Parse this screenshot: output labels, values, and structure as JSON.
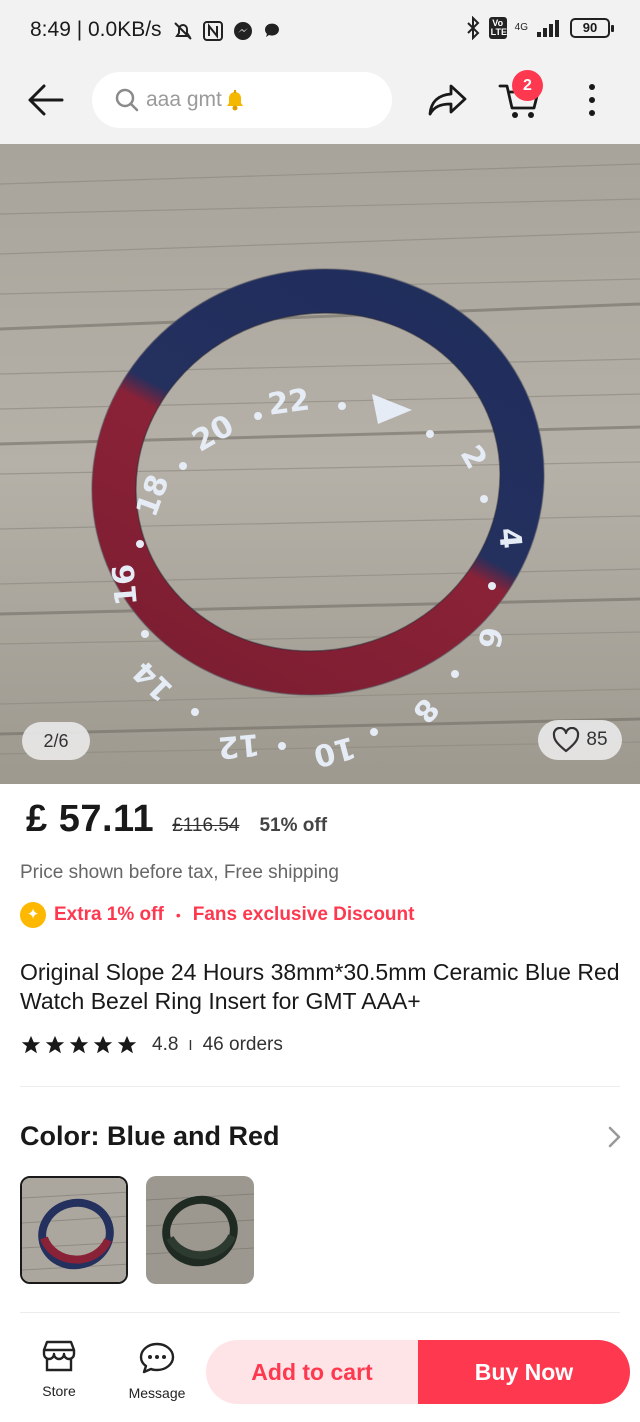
{
  "status_bar": {
    "time": "8:49",
    "net_speed": "0.0KB/s",
    "network": "4G",
    "volte": "Vo LTE",
    "battery": "90"
  },
  "nav": {
    "search_query": "aaa gmt",
    "cart_count": "2"
  },
  "gallery": {
    "counter": "2/6",
    "wishlist_count": "85"
  },
  "price": {
    "current": "£ 57.11",
    "original": "£116.54",
    "discount": "51% off",
    "tax_note": "Price shown before tax, Free shipping"
  },
  "promo": {
    "extra": "Extra 1% off",
    "fans": "Fans exclusive Discount"
  },
  "product": {
    "title": "Original Slope 24 Hours 38mm*30.5mm Ceramic Blue Red Watch Bezel Ring Insert for GMT AAA+",
    "rating": "4.8",
    "rating_stars": 5,
    "orders": "46 orders"
  },
  "variant": {
    "heading": "Color: Blue and Red"
  },
  "bottom": {
    "store": "Store",
    "message": "Message",
    "add_to_cart": "Add to cart",
    "buy_now": "Buy Now"
  },
  "colors": {
    "accent": "#fd384f",
    "accent_light": "#ffe4e7",
    "bezel_blue": "#1f2d5c",
    "bezel_red": "#8a2237",
    "promo_coin": "#ffb800"
  }
}
